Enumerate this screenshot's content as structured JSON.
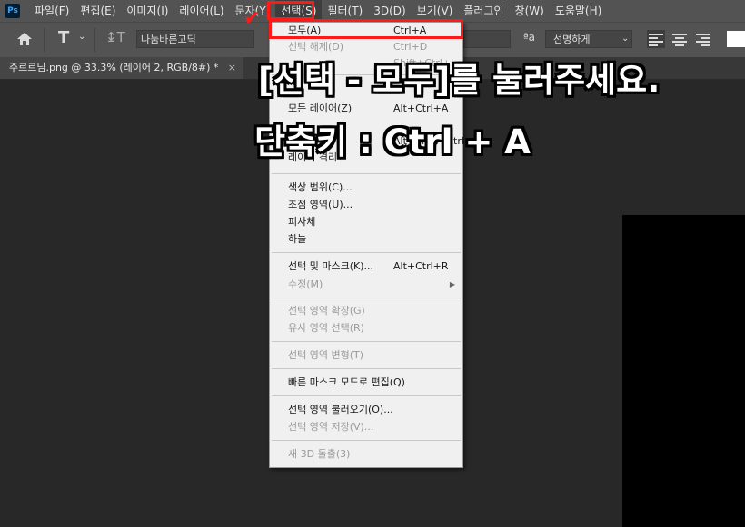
{
  "app": {
    "logo": "Ps"
  },
  "menubar": {
    "items": [
      "파일(F)",
      "편집(E)",
      "이미지(I)",
      "레이어(L)",
      "문자(Y)",
      "선택(S)",
      "필터(T)",
      "3D(D)",
      "보기(V)",
      "플러그인",
      "창(W)",
      "도움말(H)"
    ],
    "active_index": 5
  },
  "options": {
    "home_icon": "home-icon",
    "text_tool_icon": "type-tool-icon",
    "font_family": "나눔바른고딕",
    "aa_symbol": "ªa",
    "antialias": "선명하게"
  },
  "tab": {
    "title": "주르르님.png @ 33.3% (레이어 2, RGB/8#) *",
    "close": "×"
  },
  "menu": {
    "items": [
      {
        "label": "모두(A)",
        "shortcut": "Ctrl+A",
        "disabled": false
      },
      {
        "label": "선택 해제(D)",
        "shortcut": "Ctrl+D",
        "disabled": true
      },
      {
        "label": "",
        "shortcut": "Shift+Ctrl+I",
        "disabled": true
      },
      {
        "label": "모든 레이어(Z)",
        "shortcut": "Alt+Ctrl+A",
        "disabled": false
      },
      {
        "label": "",
        "shortcut": "",
        "disabled": true
      },
      {
        "label": "",
        "shortcut": "Alt+Shift+Ctrl+F",
        "disabled": false
      },
      {
        "label": "레이어 격리",
        "shortcut": "",
        "disabled": false
      },
      {
        "label": "색상 범위(C)...",
        "shortcut": "",
        "disabled": false
      },
      {
        "label": "초점 영역(U)...",
        "shortcut": "",
        "disabled": false
      },
      {
        "label": "피사체",
        "shortcut": "",
        "disabled": false
      },
      {
        "label": "하늘",
        "shortcut": "",
        "disabled": false
      },
      {
        "label": "선택 및 마스크(K)...",
        "shortcut": "Alt+Ctrl+R",
        "disabled": false
      },
      {
        "label": "수정(M)",
        "shortcut": "",
        "disabled": true,
        "submenu": true
      },
      {
        "label": "선택 영역 확장(G)",
        "shortcut": "",
        "disabled": true
      },
      {
        "label": "유사 영역 선택(R)",
        "shortcut": "",
        "disabled": true
      },
      {
        "label": "선택 영역 변형(T)",
        "shortcut": "",
        "disabled": true
      },
      {
        "label": "빠른 마스크 모드로 편집(Q)",
        "shortcut": "",
        "disabled": false
      },
      {
        "label": "선택 영역 불러오기(O)...",
        "shortcut": "",
        "disabled": false
      },
      {
        "label": "선택 영역 저장(V)...",
        "shortcut": "",
        "disabled": true
      },
      {
        "label": "새 3D 돌출(3)",
        "shortcut": "",
        "disabled": true
      }
    ]
  },
  "caption": {
    "line1": "[선택 - 모두]를 눌러주세요.",
    "line2": "단축키 : Ctrl + A"
  },
  "colors": {
    "highlight": "#ff1a1a",
    "menu_bg": "#f0f0f0",
    "app_bg": "#282828"
  }
}
